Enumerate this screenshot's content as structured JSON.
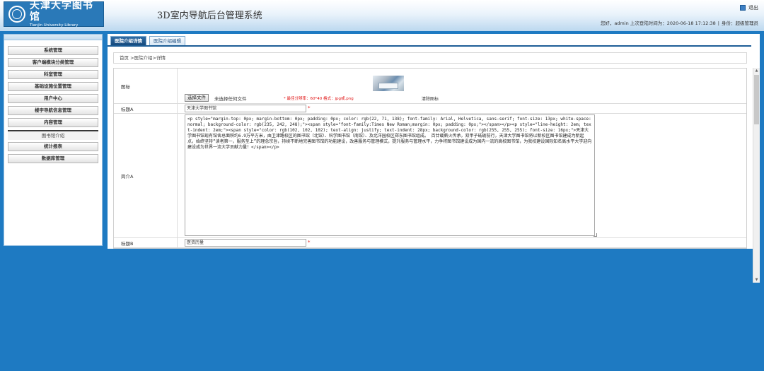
{
  "header": {
    "logo_cn": "天津大学图书馆",
    "logo_en": "Tianjin University  Library",
    "app_title": "3D室内导航后台管理系统",
    "logout_label": "退出",
    "greeting": "您好，admin 上次登陆时间为：2020-06-18 17:12:38",
    "role": "身份：超级管理员"
  },
  "sidebar": {
    "items": [
      {
        "label": "系统管理"
      },
      {
        "label": "客户端模块分类管理"
      },
      {
        "label": "科室管理"
      },
      {
        "label": "基础设施位置管理"
      },
      {
        "label": "用户中心"
      },
      {
        "label": "楼宇导航信息管理"
      },
      {
        "label": "内容管理"
      },
      {
        "label": "统计报表"
      },
      {
        "label": "数据库管理"
      }
    ],
    "sub_item": "图书馆介绍"
  },
  "tabs": [
    {
      "label": "医院介绍详情"
    },
    {
      "label": "医院介绍编辑"
    }
  ],
  "breadcrumb": "首页 >医院介绍>详情",
  "form": {
    "icon_label": "图标",
    "file_button": "选择文件",
    "file_none": "未选择任何文件",
    "icon_tip": "* 最佳分辨率：60*40  格式：jpg或.png",
    "icon_clear": "清除图标",
    "titleA_label": "标题A",
    "titleA_value": "天津大学图书馆",
    "required_mark": "*",
    "intro_label": "简介A",
    "intro_value": "<p style=\"margin-top: 0px; margin-bottom: 0px; padding: 0px; color: rgb(22, 71, 138); font-family: Arial, Helvetica, sans-serif; font-size: 13px; white-space: normal; background-color: rgb(235, 242, 248);\"><span style=\"font-family:Times New Roman;margin: 0px; padding: 0px;\"></span></p><p style=\"line-height: 2em; text-indent: 2em;\"><span style=\"color: rgb(102, 102, 102); text-align: justify; text-indent: 28px; background-color: rgb(255, 255, 255); font-size: 16px;\">天津大学图书馆现有馆舍总面积约6.9万平方米，由卫津路校区的图书馆（北馆）、科学图书馆（南馆）、及北洋园校区郑东图书馆组成。 百廿载薪火传承，双甲子砥砺前行，天津大学图书馆将以新校区图书馆建成为新起点，始终坚持“读者第一，服务至上”的理念宗旨，持续不断地完善图书馆的功能建设，改善服务与管理模式，提升服务与管理水平，力争将图书馆建设成为国内一流的高校图书馆，为我校建设国际知名高水平大学迎向建设成为世界一流大学贡献力量！</span></p>",
    "titleB_label": "标题B",
    "titleB_value": "医资历量"
  }
}
